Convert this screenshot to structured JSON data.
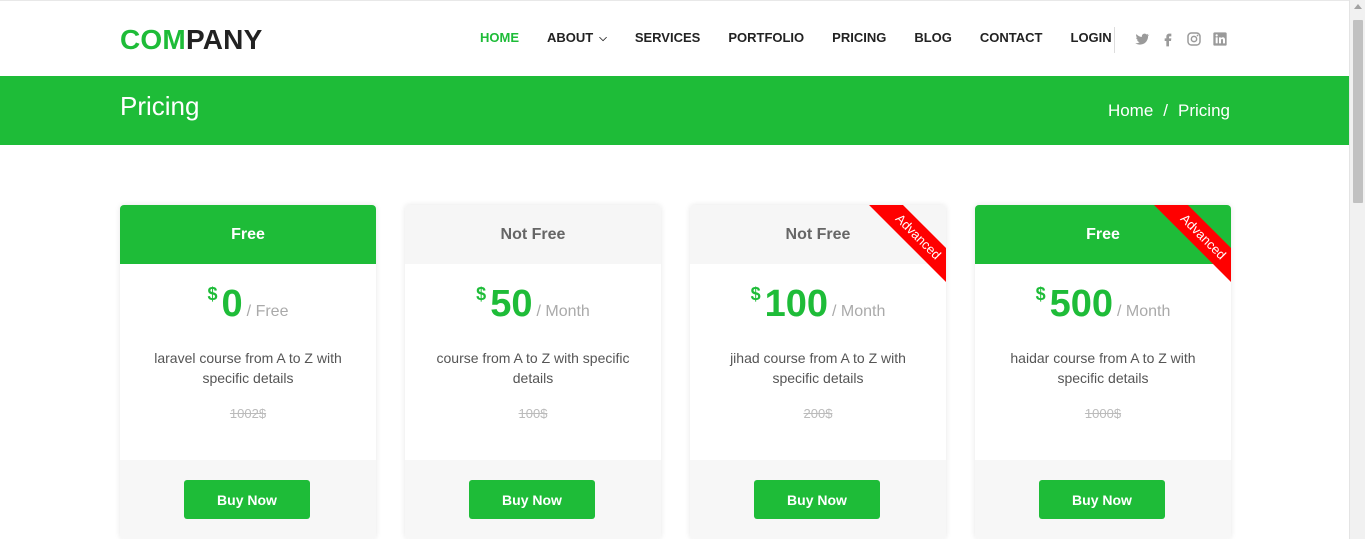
{
  "header": {
    "logo_accent": "COM",
    "logo_rest": "PANY",
    "nav": [
      {
        "label": "HOME",
        "active": true
      },
      {
        "label": "ABOUT",
        "dropdown": true
      },
      {
        "label": "SERVICES"
      },
      {
        "label": "PORTFOLIO"
      },
      {
        "label": "PRICING"
      },
      {
        "label": "BLOG"
      },
      {
        "label": "CONTACT"
      },
      {
        "label": "LOGIN"
      }
    ],
    "socials": [
      "twitter-icon",
      "facebook-icon",
      "instagram-icon",
      "linkedin-icon"
    ]
  },
  "band": {
    "title": "Pricing",
    "breadcrumb_home": "Home",
    "breadcrumb_sep": "/",
    "breadcrumb_current": "Pricing"
  },
  "plans": [
    {
      "header": "Free",
      "highlight": true,
      "currency": "$",
      "amount": "0",
      "period": "/ Free",
      "description": "laravel course from A to Z with specific details",
      "old_price": "1002$",
      "button": "Buy Now",
      "ribbon": ""
    },
    {
      "header": "Not Free",
      "highlight": false,
      "currency": "$",
      "amount": "50",
      "period": "/ Month",
      "description": "course from A to Z with specific details",
      "old_price": "100$",
      "button": "Buy Now",
      "ribbon": ""
    },
    {
      "header": "Not Free",
      "highlight": false,
      "currency": "$",
      "amount": "100",
      "period": "/ Month",
      "description": "jihad course from A to Z with specific details",
      "old_price": "200$",
      "button": "Buy Now",
      "ribbon": "Advanced"
    },
    {
      "header": "Free",
      "highlight": true,
      "currency": "$",
      "amount": "500",
      "period": "/ Month",
      "description": "haidar course from A to Z with specific details",
      "old_price": "1000$",
      "button": "Buy Now",
      "ribbon": "Advanced"
    }
  ],
  "colors": {
    "accent": "#1ebc38",
    "ribbon": "#ff0000"
  }
}
